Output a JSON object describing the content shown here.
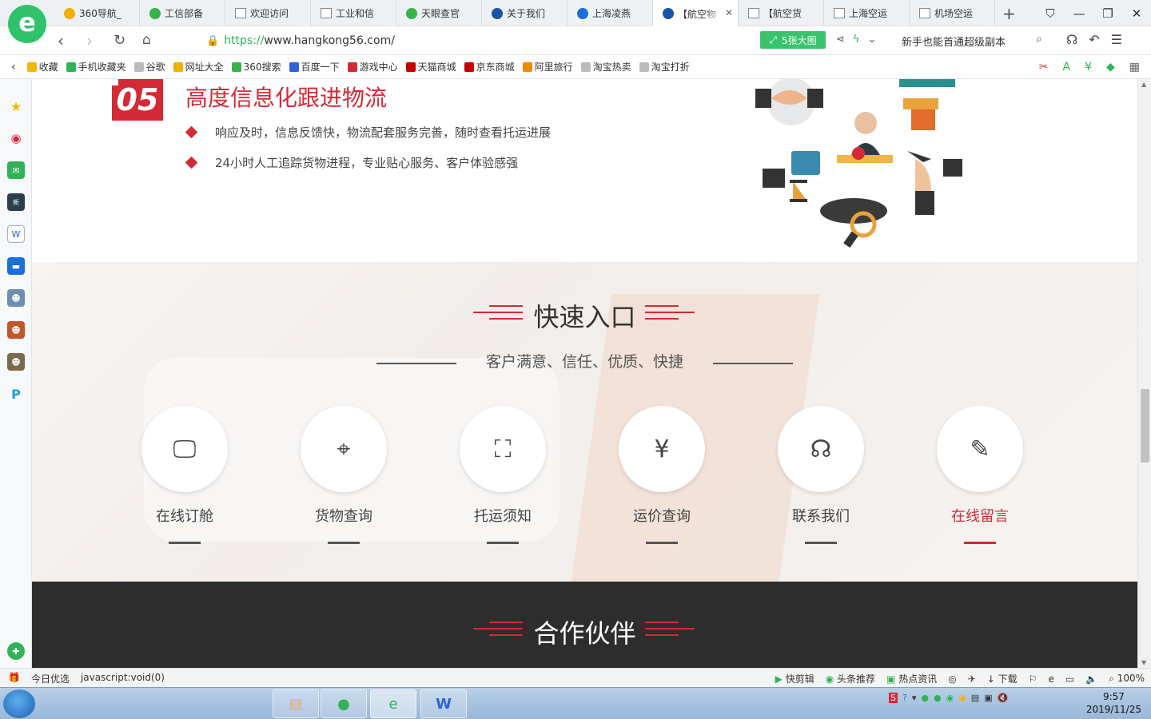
{
  "browser": {
    "tabs": [
      {
        "label": "360导航_",
        "icon_color": "#f1b100",
        "icon": "360-icon"
      },
      {
        "label": "工信部备",
        "icon_color": "#38b24a",
        "icon": "search-icon"
      },
      {
        "label": "欢迎访问",
        "icon_color": "",
        "icon": "page-icon"
      },
      {
        "label": "工业和信",
        "icon_color": "",
        "icon": "page-icon"
      },
      {
        "label": "天眼查官",
        "icon_color": "#38b24a",
        "icon": "search-icon"
      },
      {
        "label": "关于我们",
        "icon_color": "#1a55a8",
        "icon": "globe-icon"
      },
      {
        "label": "上海凌燕",
        "icon_color": "#1a6fd8",
        "icon": "ie-icon"
      },
      {
        "label": "【航空物",
        "icon_color": "#1a55a8",
        "icon": "globe-icon",
        "active": true
      },
      {
        "label": "【航空货",
        "icon_color": "",
        "icon": "page-icon"
      },
      {
        "label": "上海空运",
        "icon_color": "",
        "icon": "page-icon"
      },
      {
        "label": "机场空运",
        "icon_color": "",
        "icon": "page-icon"
      }
    ],
    "url_scheme": "https://",
    "url_rest": "www.hangkong56.com/",
    "bigpic_label": "5张大图",
    "search_hint": "新手也能首通超级副本",
    "bookmarks": [
      {
        "label": "收藏",
        "color": "#f3b700"
      },
      {
        "label": "手机收藏夹",
        "color": "#2fb356"
      },
      {
        "label": "谷歌",
        "color": "#bbbbbb"
      },
      {
        "label": "网址大全",
        "color": "#f1b100"
      },
      {
        "label": "360搜索",
        "color": "#38b24a"
      },
      {
        "label": "百度一下",
        "color": "#2f62d6"
      },
      {
        "label": "游戏中心",
        "color": "#d42a36"
      },
      {
        "label": "天猫商城",
        "color": "#c40000"
      },
      {
        "label": "京东商城",
        "color": "#c40000"
      },
      {
        "label": "阿里旅行",
        "color": "#f08a00"
      },
      {
        "label": "淘宝热卖",
        "color": "#bbbbbb"
      },
      {
        "label": "淘宝打折",
        "color": "#bbbbbb"
      }
    ]
  },
  "page": {
    "section5": {
      "number": "05",
      "title": "高度信息化跟进物流",
      "bullets": [
        "响应及时，信息反馈快，物流配套服务完善，随时查看托运进展",
        "24小时人工追踪货物进程，专业贴心服务、客户体验感强"
      ]
    },
    "quick": {
      "title": "快速入口",
      "subtitle": "客户满意、信任、优质、快捷",
      "entries": [
        {
          "label": "在线订舱",
          "icon": "monitor-icon"
        },
        {
          "label": "货物查询",
          "icon": "target-icon"
        },
        {
          "label": "托运须知",
          "icon": "map-pin-icon"
        },
        {
          "label": "运价查询",
          "icon": "yen-icon"
        },
        {
          "label": "联系我们",
          "icon": "headset-icon"
        },
        {
          "label": "在线留言",
          "icon": "edit-icon",
          "active": true
        }
      ]
    },
    "partners": {
      "title": "合作伙伴"
    }
  },
  "statusbar": {
    "left": [
      "今日优选",
      "javascript:void(0)"
    ],
    "right": [
      "快剪辑",
      "头条推荐",
      "热点资讯",
      "下载",
      "100%"
    ]
  },
  "taskbar": {
    "time": "9:57",
    "date": "2019/11/25"
  },
  "colors": {
    "brand_red": "#d42a36",
    "green": "#2fb356",
    "dark": "#2d2d2d"
  }
}
